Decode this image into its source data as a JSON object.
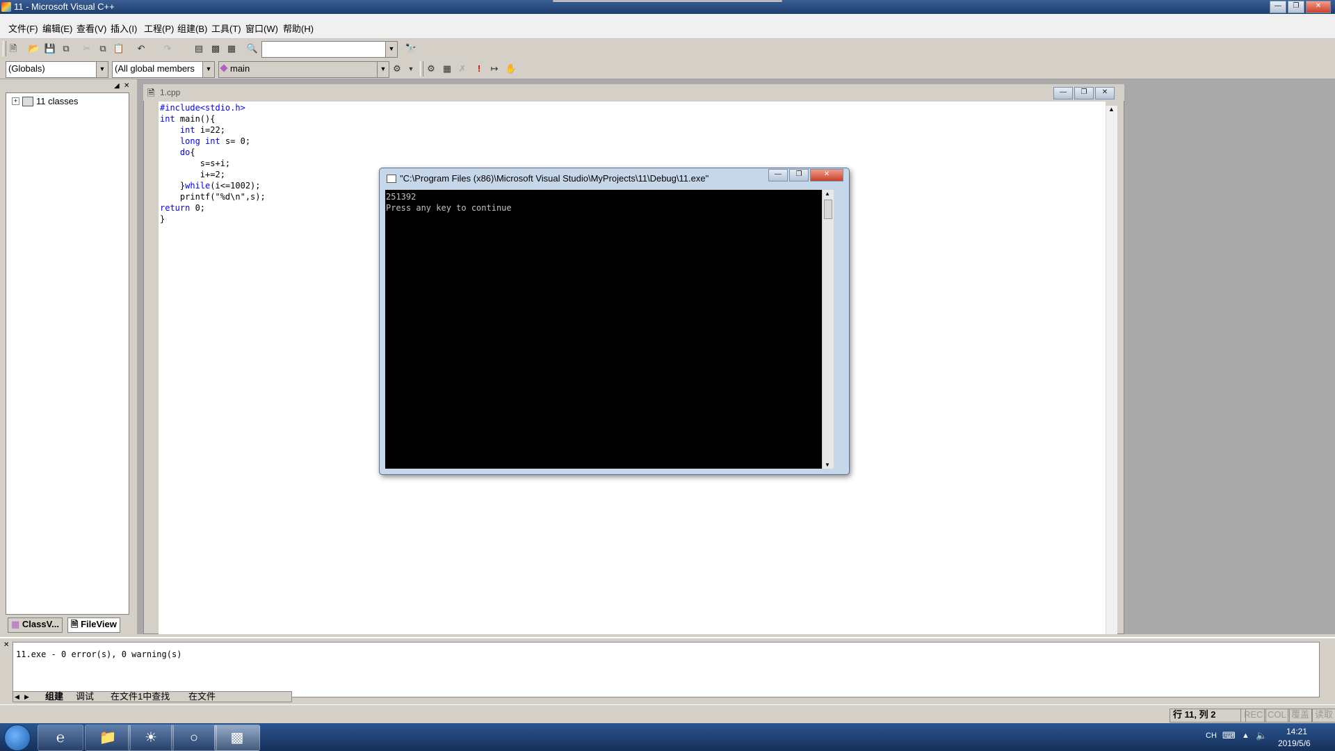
{
  "window": {
    "title": "11 - Microsoft Visual C++"
  },
  "menu": [
    "文件(F)",
    "编辑(E)",
    "查看(V)",
    "插入(I)",
    "工程(P)",
    "组建(B)",
    "工具(T)",
    "窗口(W)",
    "帮助(H)"
  ],
  "toolbar": {
    "find_combo_value": "",
    "scope_combo": "(Globals)",
    "members_combo": "(All global members",
    "function_combo": "main"
  },
  "workspace": {
    "tree_root": "11 classes",
    "tabs": [
      "ClassV...",
      "FileView"
    ]
  },
  "editor": {
    "filename": "1.cpp",
    "code": [
      [
        {
          "t": "#include<stdio.h>",
          "c": "kw"
        }
      ],
      [
        {
          "t": "int",
          "c": "kw"
        },
        {
          "t": " main(){"
        }
      ],
      [
        {
          "t": "    "
        },
        {
          "t": "int",
          "c": "kw"
        },
        {
          "t": " i=22;"
        }
      ],
      [
        {
          "t": "    "
        },
        {
          "t": "long",
          "c": "kw"
        },
        {
          "t": " "
        },
        {
          "t": "int",
          "c": "kw"
        },
        {
          "t": " s= 0;"
        }
      ],
      [
        {
          "t": "    "
        },
        {
          "t": "do",
          "c": "kw"
        },
        {
          "t": "{"
        }
      ],
      [
        {
          "t": "        s=s+i;"
        }
      ],
      [
        {
          "t": "        i+=2;"
        }
      ],
      [
        {
          "t": "    }"
        },
        {
          "t": "while",
          "c": "kw"
        },
        {
          "t": "(i<=1002);"
        }
      ],
      [
        {
          "t": "    printf(\"%d\\n\",s);"
        }
      ],
      [
        {
          "t": "return",
          "c": "kw"
        },
        {
          "t": " 0;"
        }
      ],
      [
        {
          "t": "}"
        }
      ]
    ]
  },
  "console": {
    "title": "\"C:\\Program Files (x86)\\Microsoft Visual Studio\\MyProjects\\11\\Debug\\11.exe\"",
    "lines": [
      "251392",
      "Press any key to continue"
    ]
  },
  "output": {
    "text": "11.exe - 0 error(s), 0 warning(s)",
    "tabs": [
      "组建",
      "调试",
      "在文件1中查找",
      "在文件"
    ]
  },
  "statusbar": {
    "position": "行 11, 列 2",
    "rec": "REC",
    "col": "COL",
    "ovr": "覆盖",
    "read": "读取"
  },
  "taskbar": {
    "lang": "CH",
    "time": "14:21",
    "date": "2019/5/6"
  },
  "colors": {
    "keyword": "#0000ff",
    "console_bg": "#000000",
    "taskbar": "#1e3f6e"
  }
}
